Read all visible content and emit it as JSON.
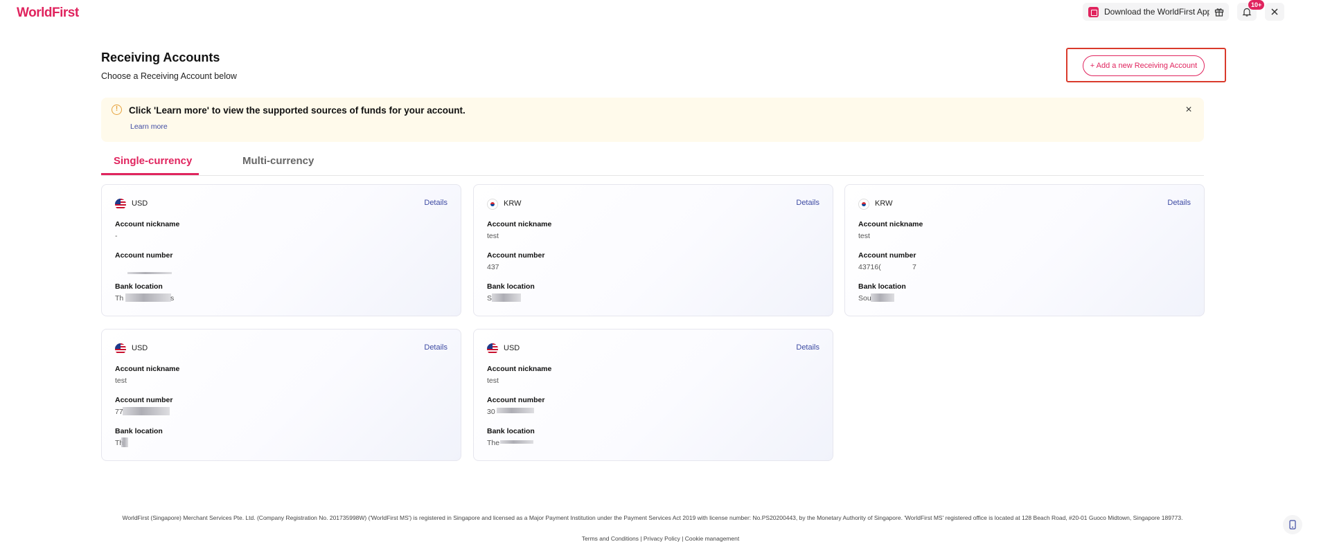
{
  "brand": {
    "logo_text": "WorldFirst",
    "accent": "#e0245e"
  },
  "header": {
    "download_app_label": "Download the WorldFirst App",
    "notification_badge": "10+"
  },
  "page": {
    "title": "Receiving Accounts",
    "subtitle": "Choose a Receiving Account below",
    "add_button_label": "+ Add a new Receiving Account"
  },
  "notice": {
    "text": "Click 'Learn more' to view the supported sources of funds for your account.",
    "link_label": "Learn more",
    "close_icon": "×"
  },
  "tabs": [
    {
      "label": "Single-currency",
      "active": true
    },
    {
      "label": "Multi-currency",
      "active": false
    }
  ],
  "labels": {
    "nickname": "Account nickname",
    "number": "Account number",
    "location": "Bank location",
    "details": "Details"
  },
  "cards": [
    {
      "currency": "USD",
      "flag": "us-flag-icon",
      "nickname": "-",
      "number": "",
      "location": "Th",
      "location_tail": "s"
    },
    {
      "currency": "KRW",
      "flag": "kr-flag-icon",
      "nickname": "test",
      "number": "437",
      "location": "S",
      "location_tail": ""
    },
    {
      "currency": "KRW",
      "flag": "kr-flag-icon",
      "nickname": "test",
      "number": "43716(",
      "number_tail": "7",
      "location": "Sou",
      "location_tail": ""
    },
    {
      "currency": "USD",
      "flag": "us-flag-icon",
      "nickname": "test",
      "number": "77",
      "location": "Th",
      "location_tail": ""
    },
    {
      "currency": "USD",
      "flag": "us-flag-icon",
      "nickname": "test",
      "number": "30",
      "location": "The",
      "location_tail": ""
    }
  ],
  "footer": {
    "legal": "WorldFirst (Singapore) Merchant Services Pte. Ltd. (Company Registration No. 201735998W) ('WorldFirst MS') is registered in Singapore and licensed as a Major Payment Institution under the Payment Services Act 2019 with license number: No.PS20200443, by the Monetary Authority of Singapore. 'WorldFirst MS' registered office is located at 128 Beach Road, #20-01 Guoco Midtown, Singapore 189773.",
    "links": "Terms and Conditions | Privacy Policy | Cookie management"
  }
}
